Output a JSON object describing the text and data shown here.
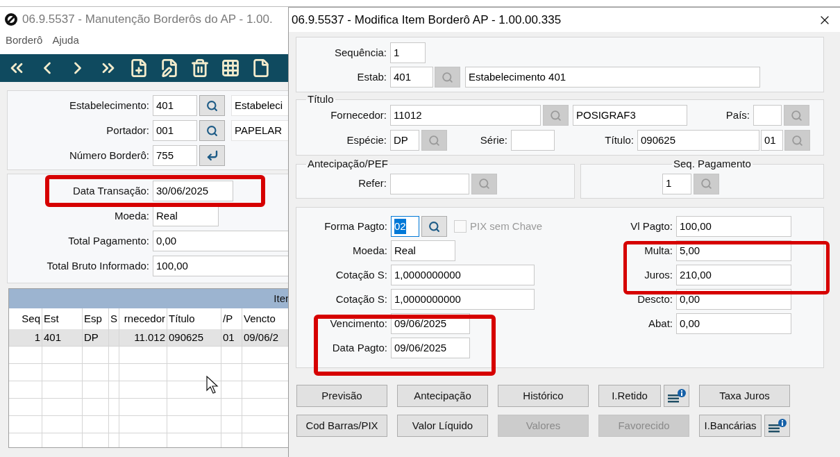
{
  "left_window": {
    "title": "06.9.5537 - Manutenção Borderôs do AP - 1.00.",
    "menu": [
      "Borderô",
      "Ajuda"
    ],
    "header_fields": [
      {
        "label": "Estabelecimento:",
        "value": "401",
        "lookup": {
          "kind": "search"
        },
        "description": "Estabeleci"
      },
      {
        "label": "Portador:",
        "value": "001",
        "lookup": {
          "kind": "search"
        },
        "description": "PAPELAR"
      },
      {
        "label": "Número Borderô:",
        "value": "755",
        "lookup": {
          "kind": "enter"
        }
      }
    ],
    "transaction_fields": [
      {
        "label": "Data Transação:",
        "value": "30/06/2025"
      },
      {
        "label": "Moeda:",
        "value": "Real"
      },
      {
        "label": "Total Pagamento:",
        "value": "0,00"
      },
      {
        "label": "Total Bruto Informado:",
        "value": "100,00"
      }
    ],
    "items_grid": {
      "title": "Iter",
      "columns": [
        "Seq",
        "Est",
        "Esp",
        "S",
        "rnecedor",
        "Título",
        "/P",
        "Vencto"
      ],
      "rows": [
        {
          "cells": [
            "1",
            "401",
            "DP",
            null,
            "11.012",
            "090625",
            "01",
            "09/06/2"
          ],
          "selected": true
        }
      ]
    }
  },
  "dialog": {
    "title": "06.9.5537 - Modifica Item Borderô AP - 1.00.00.335",
    "sequencia": {
      "label": "Sequência:",
      "value": "1"
    },
    "estab": {
      "label": "Estab:",
      "value": "401",
      "lookup": {
        "kind": "disabled"
      },
      "description": "Estabelecimento 401"
    },
    "titulo_group": {
      "legend": "Título",
      "fornecedor": {
        "label": "Fornecedor:",
        "value": "11012",
        "lookup": {
          "kind": "disabled"
        },
        "description": "POSIGRAF3"
      },
      "pais": {
        "label": "País:",
        "lookup": {
          "kind": "disabled"
        }
      },
      "especie": {
        "label": "Espécie:",
        "value": "DP",
        "lookup": {
          "kind": "disabled"
        }
      },
      "serie": {
        "label": "Série:"
      },
      "titulo": {
        "label": "Título:",
        "value": "090625",
        "parcela": "01",
        "lookup": {
          "kind": "disabled"
        }
      }
    },
    "antecipacao_group": {
      "legend": "Antecipação/PEF",
      "refer": {
        "label": "Refer:",
        "lookup": {
          "kind": "disabled"
        }
      }
    },
    "seq_pagamento_group": {
      "legend": "Seq. Pagamento",
      "value": "1",
      "lookup": {
        "kind": "disabled"
      }
    },
    "payment": {
      "forma_pagto": {
        "label": "Forma Pagto:",
        "value": "02",
        "focused": true,
        "lookup": {
          "kind": "search"
        }
      },
      "pix_sem_chave": {
        "label": "PIX sem Chave",
        "checked": false,
        "disabled": true
      },
      "left_fields": [
        {
          "label": "Moeda:",
          "value": "Real"
        },
        {
          "label": "Cotação S:",
          "value": "1,0000000000"
        },
        {
          "label": "Cotação S:",
          "value": "1,0000000000"
        },
        {
          "label": "Vencimento:",
          "value": "09/06/2025"
        },
        {
          "label": "Data Pagto:",
          "value": "09/06/2025"
        }
      ],
      "right_fields": [
        {
          "label": "Vl Pagto:",
          "value": "100,00"
        },
        {
          "label": "Multa:",
          "value": "5,00"
        },
        {
          "label": "Juros:",
          "value": "210,00"
        },
        {
          "label": "Descto:",
          "value": "0,00"
        },
        {
          "label": "Abat:",
          "value": "0,00"
        }
      ]
    },
    "button_rows": [
      {
        "buttons": [
          {
            "label": "Previsão",
            "disabled": false,
            "info": false
          },
          {
            "label": "Antecipação",
            "disabled": false,
            "info": false
          },
          {
            "label": "Histórico",
            "disabled": false,
            "info": false
          },
          {
            "label": "I.Retido",
            "disabled": false,
            "info": true
          },
          {
            "label": "Taxa Juros",
            "disabled": false,
            "info": false
          }
        ]
      },
      {
        "buttons": [
          {
            "label": "Cod Barras/PIX",
            "disabled": false,
            "info": false
          },
          {
            "label": "Valor Líquido",
            "disabled": false,
            "info": false
          },
          {
            "label": "Valores",
            "disabled": true,
            "info": false
          },
          {
            "label": "Favorecido",
            "disabled": true,
            "info": false
          },
          {
            "label": "I.Bancárias",
            "disabled": false,
            "info": true
          }
        ]
      }
    ]
  }
}
